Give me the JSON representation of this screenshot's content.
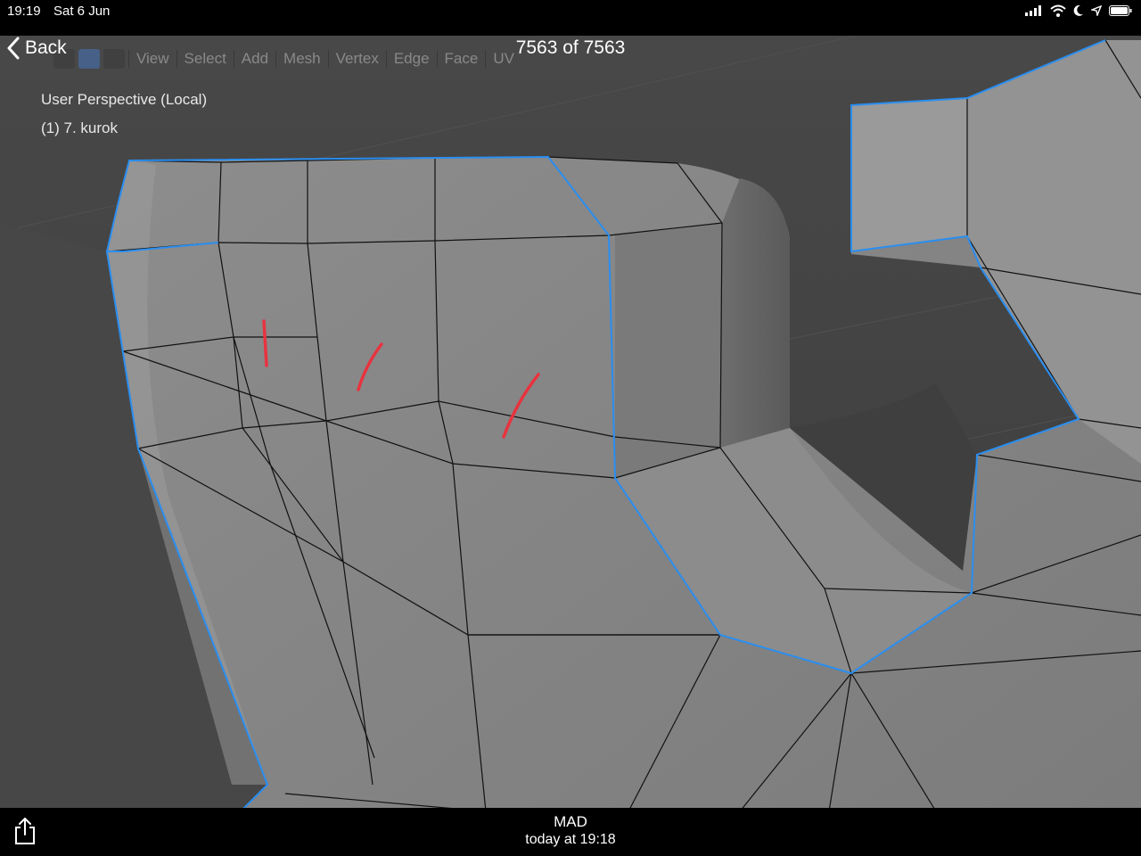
{
  "status_bar": {
    "time": "19:19",
    "date": "Sat 6 Jun"
  },
  "nav": {
    "back_label": "Back",
    "title": "7563 of 7563"
  },
  "blender": {
    "menu": [
      "View",
      "Select",
      "Add",
      "Mesh",
      "Vertex",
      "Edge",
      "Face",
      "UV"
    ],
    "viewport_label": "User Perspective (Local)",
    "object_label": "(1) 7. kurok"
  },
  "footer": {
    "sender": "MAD",
    "timestamp": "today at 19:18"
  },
  "colors": {
    "selection": "#2a8ef0",
    "annotation": "#e8333f",
    "background": "#444444",
    "mesh": "#8a8a8a"
  }
}
